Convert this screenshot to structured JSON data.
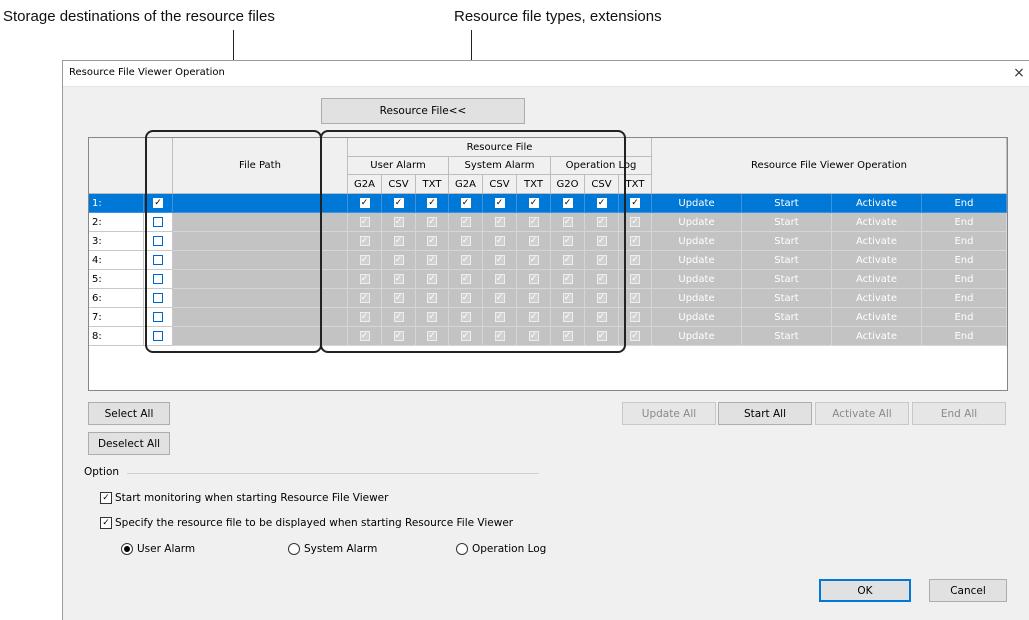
{
  "callouts": {
    "left": "Storage destinations of the resource files",
    "right": "Resource file types, extensions"
  },
  "dialog": {
    "title": "Resource File Viewer Operation",
    "close": "×",
    "toggle_button": "Resource File<<"
  },
  "grid": {
    "file_path_header": "File Path",
    "resource_file_header": "Resource File",
    "groups": [
      "User Alarm",
      "System Alarm",
      "Operation Log"
    ],
    "ext": [
      "G2A",
      "CSV",
      "TXT",
      "G2A",
      "CSV",
      "TXT",
      "G2O",
      "CSV",
      "TXT"
    ],
    "operation_header": "Resource File Viewer Operation",
    "actions": [
      "Update",
      "Start",
      "Activate",
      "End"
    ],
    "rows": [
      {
        "num": "1:",
        "checked": true
      },
      {
        "num": "2:",
        "checked": false
      },
      {
        "num": "3:",
        "checked": false
      },
      {
        "num": "4:",
        "checked": false
      },
      {
        "num": "5:",
        "checked": false
      },
      {
        "num": "6:",
        "checked": false
      },
      {
        "num": "7:",
        "checked": false
      },
      {
        "num": "8:",
        "checked": false
      }
    ]
  },
  "buttons": {
    "select_all": "Select All",
    "deselect_all": "Deselect All",
    "update_all": "Update All",
    "start_all": "Start All",
    "activate_all": "Activate All",
    "end_all": "End All",
    "ok": "OK",
    "cancel": "Cancel"
  },
  "option": {
    "label": "Option",
    "start_monitoring": "Start monitoring when starting Resource File Viewer",
    "specify_file": "Specify the resource file to be displayed when starting Resource File Viewer",
    "radios": [
      "User Alarm",
      "System Alarm",
      "Operation Log"
    ],
    "selected_radio": "User Alarm"
  }
}
